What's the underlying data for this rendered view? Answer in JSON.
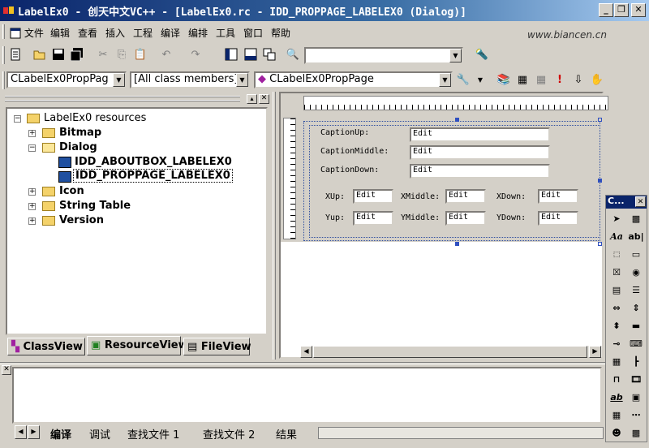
{
  "window": {
    "title": "LabelEx0 - 创天中文VC++ - [LabelEx0.rc - IDD_PROPPAGE_LABELEX0 (Dialog)]"
  },
  "watermark": "www.biancen.cn",
  "menu": [
    "文件",
    "编辑",
    "查看",
    "插入",
    "工程",
    "编译",
    "编排",
    "工具",
    "窗口",
    "帮助"
  ],
  "wizardbar": {
    "class_combo": "CLabelEx0PropPag",
    "filter_combo": "[All class members]",
    "member_combo": "CLabelEx0PropPage"
  },
  "tree": {
    "root": "LabelEx0 resources",
    "nodes": [
      "Bitmap",
      "Dialog",
      "IDD_ABOUTBOX_LABELEX0",
      "IDD_PROPPAGE_LABELEX0",
      "Icon",
      "String Table",
      "Version"
    ]
  },
  "workspace_tabs": [
    "ClassView",
    "ResourceView",
    "FileView"
  ],
  "dialog": {
    "labels": {
      "caption_up": "CaptionUp:",
      "caption_middle": "CaptionMiddle:",
      "caption_down": "CaptionDown:",
      "xup": "XUp:",
      "xmiddle": "XMiddle:",
      "xdown": "XDown:",
      "yup": "Yup:",
      "ymiddle": "YMiddle:",
      "ydown": "YDown:"
    },
    "edit_text": "Edit"
  },
  "palette_title": "C...",
  "output_tabs": [
    "编译",
    "调试",
    "查找文件 1",
    "查找文件 2",
    "结果"
  ]
}
